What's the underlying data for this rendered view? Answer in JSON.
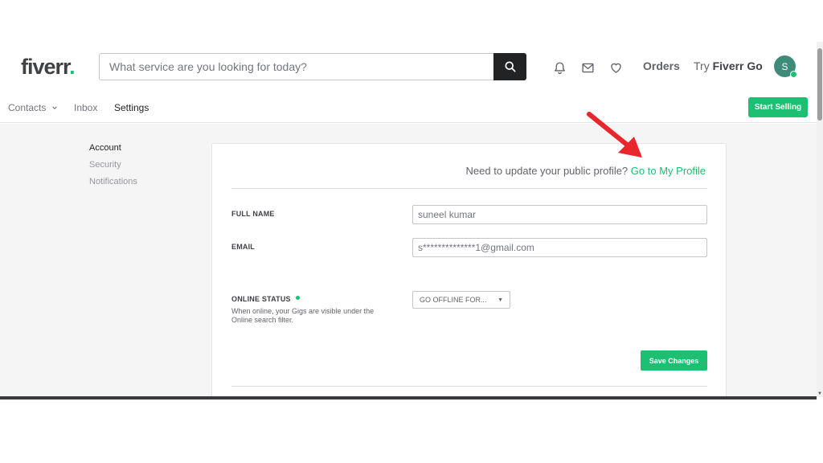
{
  "header": {
    "logo_text": "fiverr",
    "logo_dot": ".",
    "search_placeholder": "What service are you looking for today?",
    "orders_label": "Orders",
    "try_prefix": "Try",
    "try_brand": "Fiverr Go",
    "avatar_initial": "S",
    "icons": [
      "search-icon",
      "bell-icon",
      "mail-icon",
      "heart-icon"
    ]
  },
  "subnav": {
    "items": [
      {
        "label": "Contacts"
      },
      {
        "label": "Inbox"
      },
      {
        "label": "Settings"
      }
    ],
    "start_selling_label": "Start Selling"
  },
  "leftnav": {
    "items": [
      {
        "label": "Account"
      },
      {
        "label": "Security"
      },
      {
        "label": "Notifications"
      }
    ]
  },
  "card": {
    "profile_note": "Need to update your public profile?",
    "profile_link": "Go to My Profile",
    "full_name_label": "FULL NAME",
    "full_name_value": "suneel kumar",
    "email_label": "EMAIL",
    "email_value": "s**************1@gmail.com",
    "online_status_label": "ONLINE STATUS",
    "online_status_help": "When online, your Gigs are visible under the Online search filter.",
    "online_status_select": "GO OFFLINE FOR...",
    "save_label": "Save Changes"
  },
  "colors": {
    "brand_green": "#1dbf73",
    "annotation_red": "#e8262b",
    "text_dark": "#404145"
  }
}
